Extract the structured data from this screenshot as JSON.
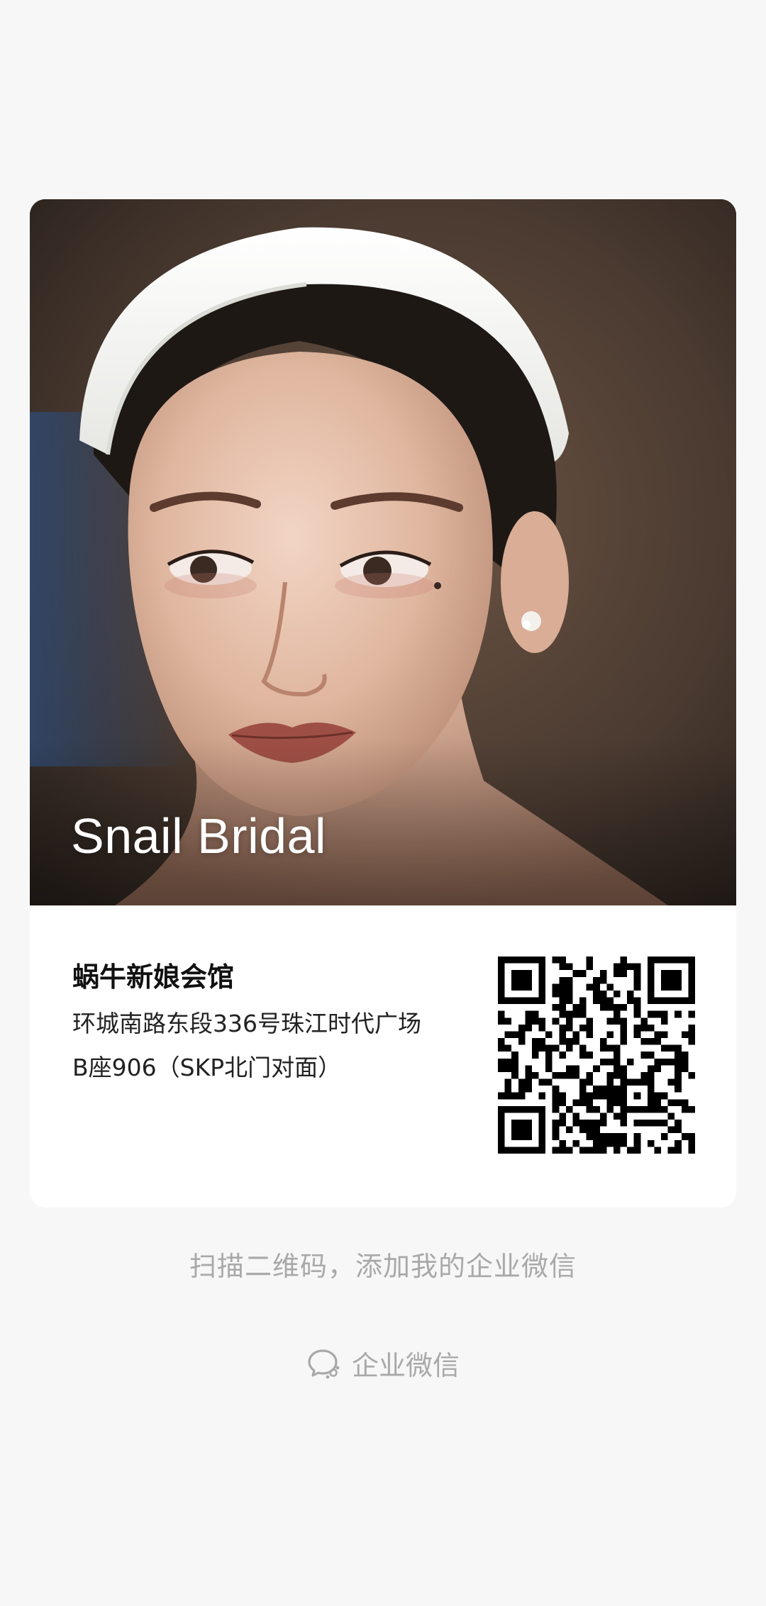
{
  "card": {
    "photo_title": "Snail Bridal",
    "company_name": "蜗牛新娘会馆",
    "address_line1": "环城南路东段336号珠江时代广场",
    "address_line2": "B座906（SKP北门对面）"
  },
  "footer": {
    "scan_hint": "扫描二维码，添加我的企业微信",
    "brand_label": "企业微信"
  },
  "icons": {
    "brand_icon": "wecom-chat-bubbles-icon",
    "qr_code": "qr-code"
  },
  "colors": {
    "page_background": "#f7f7f7",
    "card_background": "#ffffff",
    "hint_text": "#a9a9a9"
  }
}
